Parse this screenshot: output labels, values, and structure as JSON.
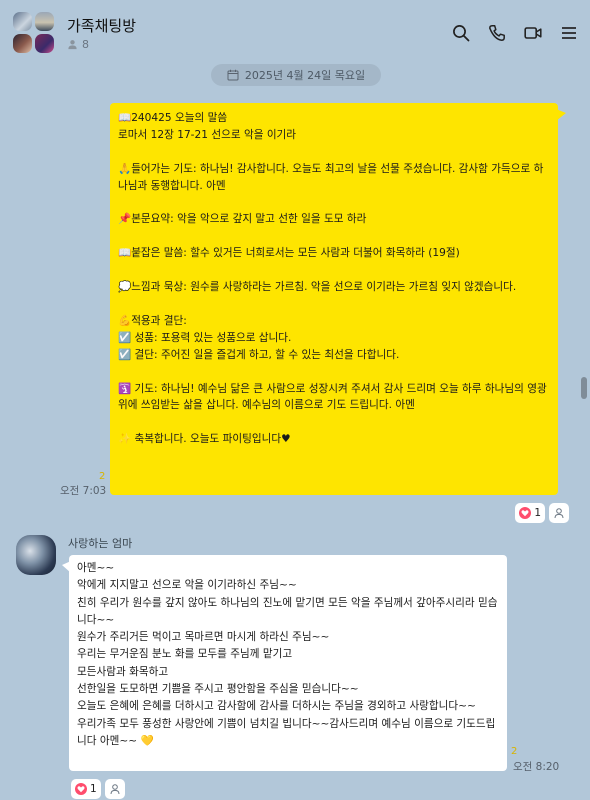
{
  "header": {
    "room_title": "가족채팅방",
    "member_count": "8",
    "icons": [
      "search-icon",
      "phone-icon",
      "video-call-icon",
      "menu-icon"
    ]
  },
  "date_divider": "2025년 4월 24일 목요일",
  "messages": [
    {
      "direction": "outgoing",
      "text": "📖240425 오늘의 말씀\n로마서 12장 17-21 선으로 악을 이기라\n\n🙏들어가는 기도: 하나님! 감사합니다. 오늘도 최고의 날을 선물 주셨습니다. 감사함 가득으로 하나님과 동행합니다. 아멘\n\n📌본문요약: 악을 악으로 갚지 말고 선한 일을 도모 하라\n\n📖붙잡은 말씀: 할수 있거든 너희로서는 모든 사람과 더불어 화목하라 (19절)\n\n💭느낌과 묵상: 원수를 사랑하라는 가르침. 악을 선으로 이기라는 가르침 잊지 않겠습니다.\n\n💪적용과 결단:\n☑️ 성품: 포용력 있는 성품으로 삽니다.\n☑️ 결단: 주어진 일을 즐겁게 하고, 할 수 있는 최선을 다합니다.\n\n🛐 기도: 하나님! 예수님 닮은 큰 사람으로 성장시켜 주셔서 감사 드리며 오늘 하루 하나님의 영광위에 쓰임받는 삶을 삽니다. 예수님의 이름으로 기도 드립니다. 아멘\n\n✨ 축복합니다. 오늘도 파이팅입니다♥",
      "read_count": "2",
      "time": "오전 7:03",
      "reactions": [
        {
          "icon": "heart-icon",
          "count": "1"
        },
        {
          "icon": "person-icon"
        }
      ]
    },
    {
      "direction": "incoming",
      "sender": "사랑하는 엄마",
      "text": "아멘~~\n악에게 지지말고 선으로 악을 이기라하신 주님~~\n친히 우리가 원수를 갚지 않아도 하나님의 진노에 맡기면 모든 악을 주님께서 갚아주시리라 믿습니다~~\n원수가 주리거든 먹이고 목마르면 마시게 하라신 주님~~\n우리는 무거운짐 분노 화를 모두를 주님께 맡기고\n모든사람과 화목하고\n선한일을 도모하면 기쁨을 주시고 평안함을 주심을 믿습니다~~\n오늘도 은혜에 은혜를 더하시고 감사함에 감사를 더하시는 주님을 경외하고 사랑합니다~~\n우리가족 모두 풍성한 사랑안에 기쁨이 넘치길 빕니다~~감사드리며 예수님 이름으로 기도드립니다 아멘~~ 💛",
      "read_count": "2",
      "time": "오전 8:20",
      "reactions": [
        {
          "icon": "heart-icon",
          "count": "1"
        },
        {
          "icon": "person-icon"
        }
      ]
    }
  ],
  "colors": {
    "background": "#b2c7d9",
    "my_bubble": "#fee500",
    "their_bubble": "#ffffff",
    "reaction_heart": "#ff4d6d"
  }
}
